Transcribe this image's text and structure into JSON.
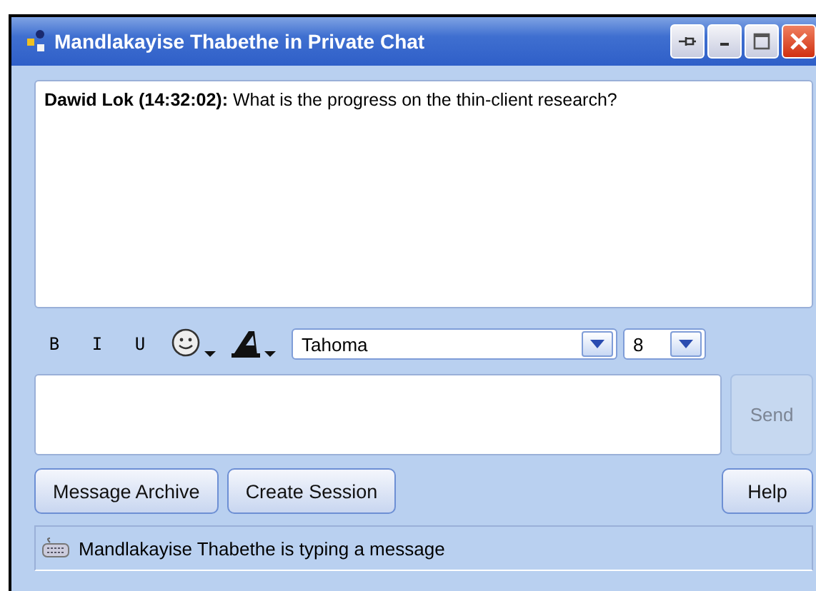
{
  "window": {
    "title": "Mandlakayise Thabethe in Private Chat"
  },
  "messages": [
    {
      "sender": "Dawid Lok (14:32:02):",
      "text": "What is the progress on the thin-client research?"
    }
  ],
  "format_toolbar": {
    "bold": "B",
    "italic": "I",
    "underline": "U",
    "font": "Tahoma",
    "size": "8"
  },
  "compose": {
    "send": {
      "label": "Send",
      "disabled": true
    }
  },
  "buttons": [
    {
      "label": "Message Archive"
    },
    {
      "label": "Create Session"
    }
  ],
  "help_button": {
    "label": "Help"
  },
  "status_bar": {
    "text": "Mandlakayise Thabethe is typing a message"
  }
}
